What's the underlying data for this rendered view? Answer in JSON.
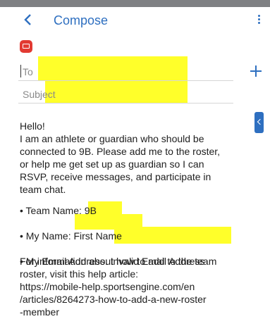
{
  "header": {
    "title": "Compose",
    "back_icon": "chevron-left-icon",
    "more_icon": "more-vertical-icon"
  },
  "compose": {
    "app_icon": "mail-app-icon",
    "to_label": "To",
    "subject_label": "Subject",
    "add_recipient_icon": "plus-icon"
  },
  "message": {
    "greeting": "Hello!",
    "intro_lines": [
      "I am an athlete or guardian who should be",
      "connected to 9B. Please add me to the roster,",
      "or help me get set up as guardian so I can",
      "RSVP, receive messages, and participate in",
      "team chat."
    ],
    "details": [
      {
        "label": "• Team Name: ",
        "value": "9B"
      },
      {
        "label": "• My Name: ",
        "value": "First Name"
      },
      {
        "label": "• My Email Address: ",
        "value": "Invalid Email Address"
      }
    ],
    "footer_lines": [
      "For information about how to add to the team",
      "roster, visit this help article:",
      "https://mobile-help.sportsengine.com/en",
      "/articles/8264273-how-to-add-a-new-roster",
      "-member"
    ]
  },
  "colors": {
    "accent": "#2e6fc0",
    "highlight": "#ffff2a",
    "app_icon": "#e23a32"
  }
}
